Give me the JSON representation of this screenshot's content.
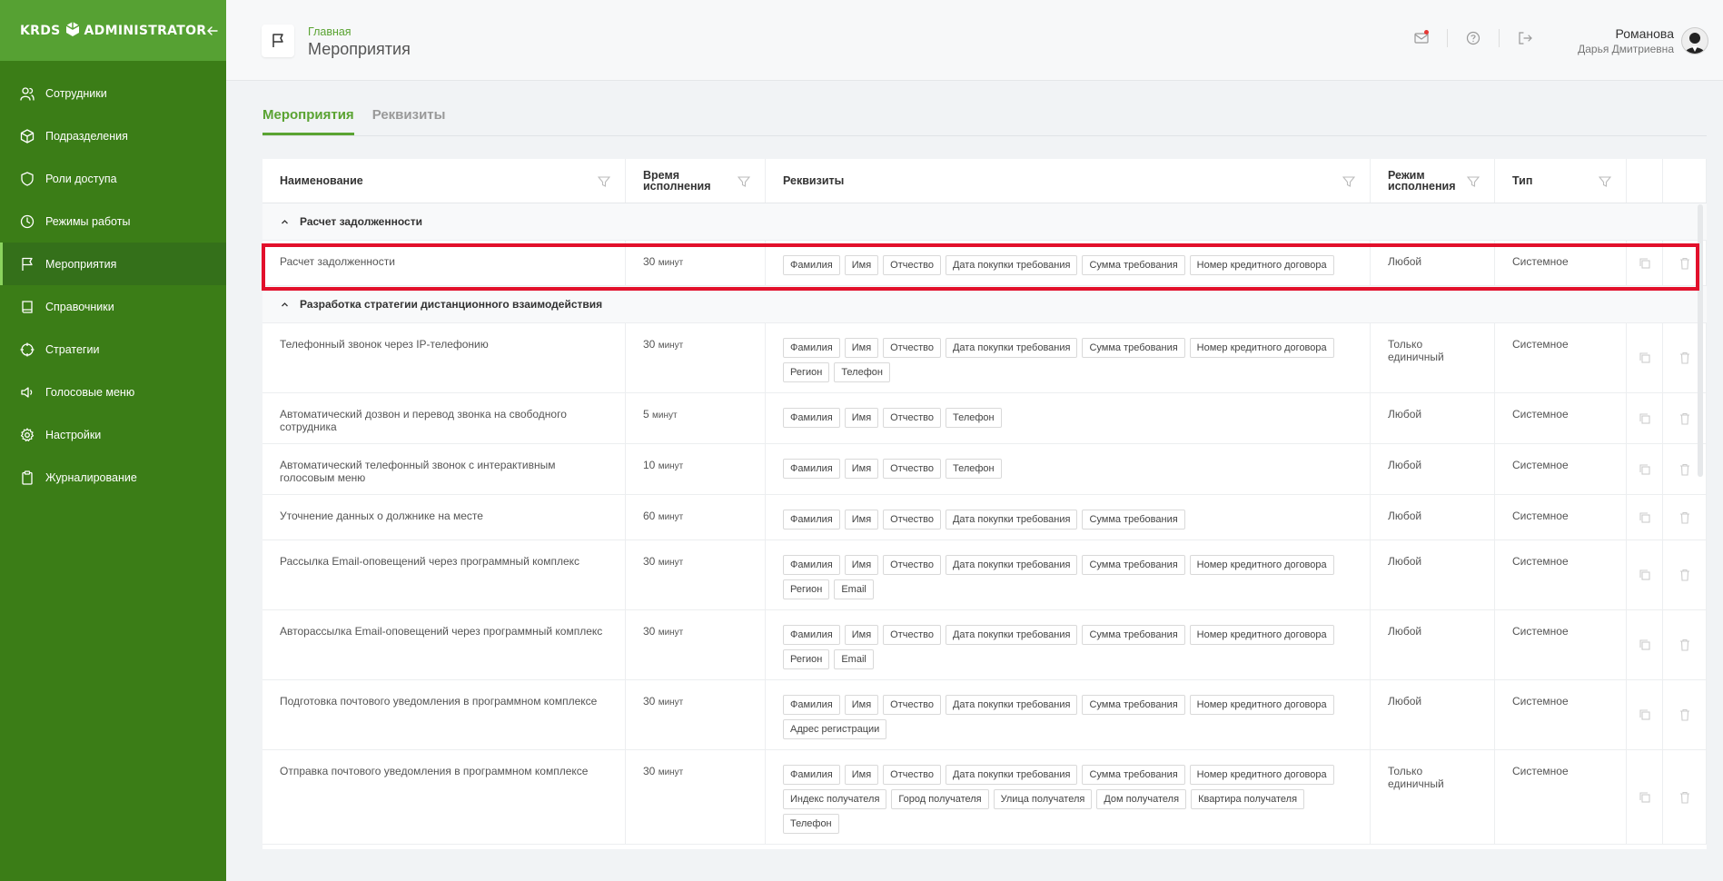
{
  "app": {
    "logo_left": "KRDS",
    "logo_right": "ADMINISTRATOR"
  },
  "sidebar": {
    "items": [
      {
        "label": "Сотрудники",
        "icon": "users-icon"
      },
      {
        "label": "Подразделения",
        "icon": "cube-icon"
      },
      {
        "label": "Роли доступа",
        "icon": "shield-icon"
      },
      {
        "label": "Режимы работы",
        "icon": "clock-icon"
      },
      {
        "label": "Мероприятия",
        "icon": "flag-icon",
        "active": true
      },
      {
        "label": "Справочники",
        "icon": "book-icon"
      },
      {
        "label": "Стратегии",
        "icon": "target-icon"
      },
      {
        "label": "Голосовые меню",
        "icon": "speaker-icon"
      },
      {
        "label": "Настройки",
        "icon": "gear-icon"
      },
      {
        "label": "Журналирование",
        "icon": "clipboard-icon"
      }
    ]
  },
  "header": {
    "breadcrumb": "Главная",
    "title": "Мероприятия",
    "user_last": "Романова",
    "user_first": "Дарья Дмитриевна"
  },
  "tabs": [
    "Мероприятия",
    "Реквизиты"
  ],
  "table": {
    "columns": {
      "name": "Наименование",
      "time": "Время исполнения",
      "req": "Реквизиты",
      "mode": "Режим исполнения",
      "type": "Тип"
    },
    "groups": [
      {
        "title": "Расчет задолженности",
        "rows": [
          {
            "name": "Расчет задолженности",
            "time": "30",
            "unit": "минут",
            "tags": [
              "Фамилия",
              "Имя",
              "Отчество",
              "Дата покупки требования",
              "Сумма требования",
              "Номер кредитного договора"
            ],
            "mode": "Любой",
            "type": "Системное"
          }
        ]
      },
      {
        "title": "Разработка стратегии дистанционного взаимодействия",
        "rows": [
          {
            "name": "Телефонный звонок через IP-телефонию",
            "time": "30",
            "unit": "минут",
            "tags": [
              "Фамилия",
              "Имя",
              "Отчество",
              "Дата покупки требования",
              "Сумма требования",
              "Номер кредитного договора",
              "Регион",
              "Телефон"
            ],
            "mode": "Только единичный",
            "type": "Системное"
          },
          {
            "name": "Автоматический дозвон и перевод звонка на свободного сотрудника",
            "time": "5",
            "unit": "минут",
            "tags": [
              "Фамилия",
              "Имя",
              "Отчество",
              "Телефон"
            ],
            "mode": "Любой",
            "type": "Системное"
          },
          {
            "name": "Автоматический телефонный звонок с интерактивным голосовым меню",
            "time": "10",
            "unit": "минут",
            "tags": [
              "Фамилия",
              "Имя",
              "Отчество",
              "Телефон"
            ],
            "mode": "Любой",
            "type": "Системное"
          },
          {
            "name": "Уточнение данных о должнике на месте",
            "time": "60",
            "unit": "минут",
            "tags": [
              "Фамилия",
              "Имя",
              "Отчество",
              "Дата покупки требования",
              "Сумма требования"
            ],
            "mode": "Любой",
            "type": "Системное"
          },
          {
            "name": "Рассылка Email-оповещений через программный комплекс",
            "time": "30",
            "unit": "минут",
            "tags": [
              "Фамилия",
              "Имя",
              "Отчество",
              "Дата покупки требования",
              "Сумма требования",
              "Номер кредитного договора",
              "Регион",
              "Email"
            ],
            "mode": "Любой",
            "type": "Системное"
          },
          {
            "name": "Авторассылка Email-оповещений через программный комплекс",
            "time": "30",
            "unit": "минут",
            "tags": [
              "Фамилия",
              "Имя",
              "Отчество",
              "Дата покупки требования",
              "Сумма требования",
              "Номер кредитного договора",
              "Регион",
              "Email"
            ],
            "mode": "Любой",
            "type": "Системное"
          },
          {
            "name": "Подготовка почтового уведомления в программном комплексе",
            "time": "30",
            "unit": "минут",
            "tags": [
              "Фамилия",
              "Имя",
              "Отчество",
              "Дата покупки требования",
              "Сумма требования",
              "Номер кредитного договора",
              "Адрес регистрации"
            ],
            "mode": "Любой",
            "type": "Системное"
          },
          {
            "name": "Отправка почтового уведомления в программном комплексе",
            "time": "30",
            "unit": "минут",
            "tags": [
              "Фамилия",
              "Имя",
              "Отчество",
              "Дата покупки требования",
              "Сумма требования",
              "Номер кредитного договора",
              "Индекс получателя",
              "Город получателя",
              "Улица получателя",
              "Дом получателя",
              "Квартира получателя",
              "Телефон"
            ],
            "mode": "Только единичный",
            "type": "Системное"
          }
        ]
      }
    ]
  }
}
